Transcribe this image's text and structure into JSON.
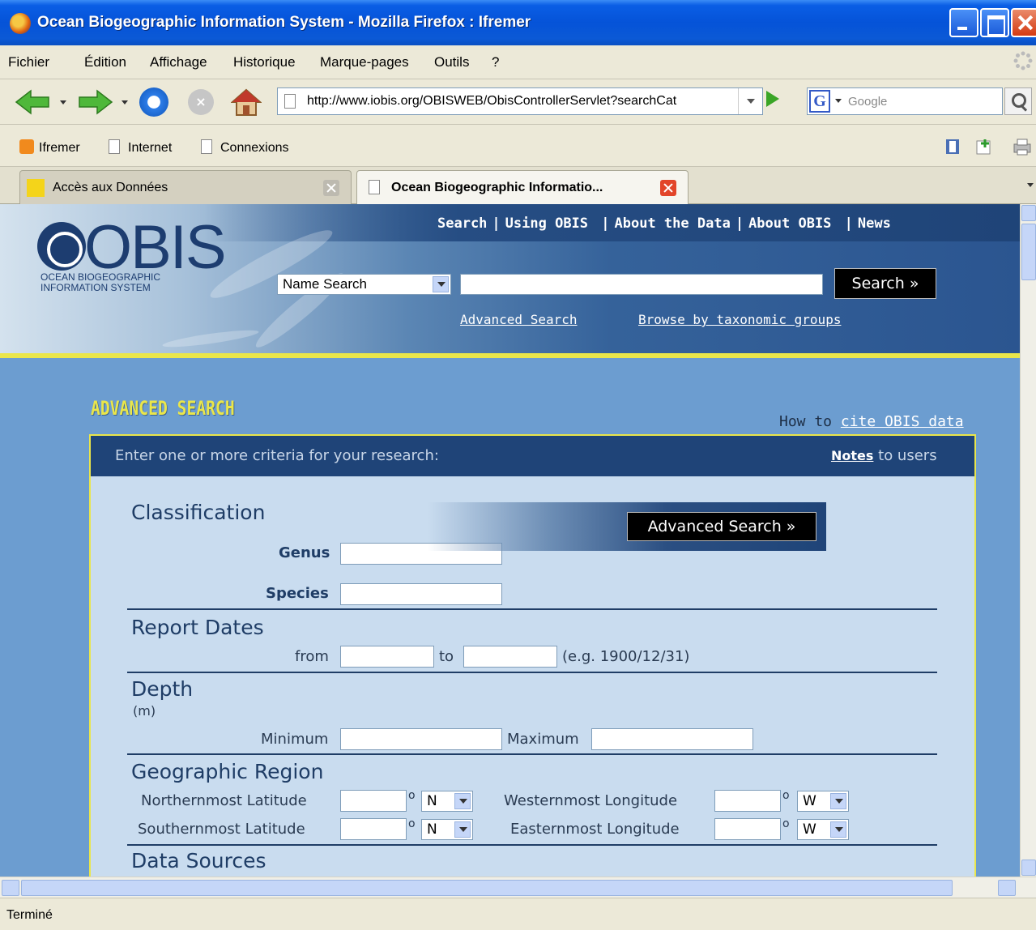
{
  "window": {
    "title": "Ocean Biogeographic Information System - Mozilla Firefox : Ifremer"
  },
  "menu": [
    "Fichier",
    "Édition",
    "Affichage",
    "Historique",
    "Marque-pages",
    "Outils",
    "?"
  ],
  "nav": {
    "url": "http://www.iobis.org/OBISWEB/ObisControllerServlet?searchCat",
    "search_placeholder": "Google",
    "search_engine_letter": "G"
  },
  "bookmarks": [
    "Ifremer",
    "Internet",
    "Connexions"
  ],
  "tabs": [
    {
      "label": "Accès aux Données",
      "active": false
    },
    {
      "label": "Ocean Biogeographic Informatio...",
      "active": true
    }
  ],
  "status": "Terminé",
  "obis": {
    "logo": "OBIS",
    "logo_sub": "OCEAN BIOGEOGRAPHIC\nINFORMATION SYSTEM",
    "topnav": [
      "Search",
      "Using OBIS",
      "About the Data",
      "About OBIS",
      "News"
    ],
    "search_type": "Name Search",
    "search_button": "Search »",
    "link_advanced": "Advanced Search",
    "link_browse": "Browse by taxonomic groups"
  },
  "advanced": {
    "title": "ADVANCED SEARCH",
    "cite_prefix": "How to",
    "cite_link": "cite OBIS data",
    "criteria": "Enter one or more criteria for your research:",
    "notes_link": "Notes",
    "notes_suffix": "to users",
    "button": "Advanced Search »",
    "sections": {
      "classification": "Classification",
      "genus": "Genus",
      "species": "Species",
      "report_dates": "Report Dates",
      "from": "from",
      "to": "to",
      "date_example": "(e.g. 1900/12/31)",
      "depth": "Depth",
      "depth_unit": "(m)",
      "minimum": "Minimum",
      "maximum": "Maximum",
      "geo": "Geographic Region",
      "north_lat": "Northernmost Latitude",
      "south_lat": "Southernmost Latitude",
      "west_lon": "Westernmost Longitude",
      "east_lon": "Easternmost Longitude",
      "lat_dir": "N",
      "lon_dir": "W",
      "data_sources": "Data Sources"
    }
  }
}
